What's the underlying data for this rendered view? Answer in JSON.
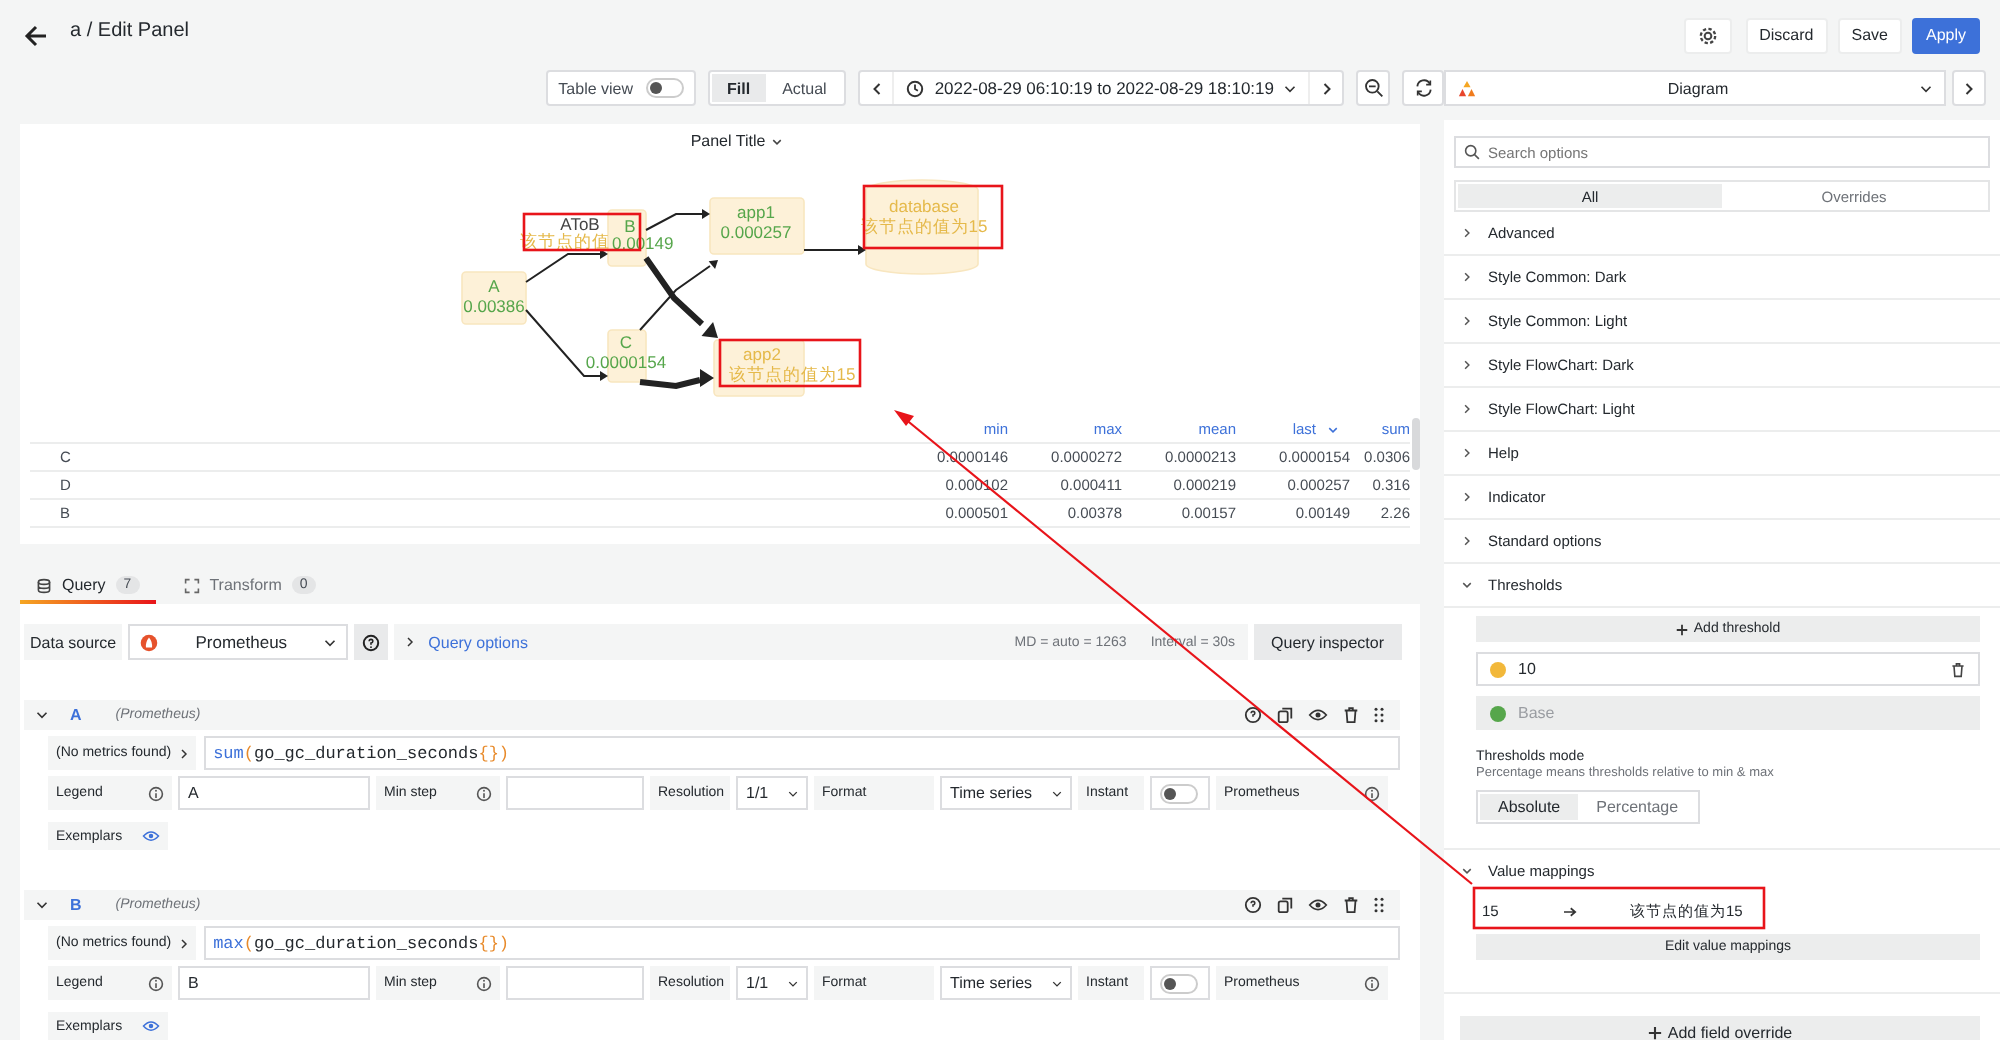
{
  "header": {
    "breadcrumb": "a / Edit Panel",
    "buttons": [
      {
        "label": "Discard",
        "kind": "secondary"
      },
      {
        "label": "Save",
        "kind": "secondary"
      },
      {
        "label": "Apply",
        "kind": "primary"
      }
    ]
  },
  "toolbar": {
    "table_view": {
      "label": "Table view",
      "on": false
    },
    "fill_modes": [
      {
        "label": "Fill",
        "selected": true
      },
      {
        "label": "Actual",
        "selected": false
      }
    ],
    "time_range": "2022-08-29 06:10:19 to 2022-08-29 18:10:19"
  },
  "visualization": {
    "name": "Diagram"
  },
  "panel": {
    "title": "Panel Title",
    "nodes": [
      {
        "label": "A",
        "value": "0.00386",
        "color": "#56a64b"
      },
      {
        "label": "B",
        "value": "0.00149",
        "color": "#56a64b"
      },
      {
        "label": "app1",
        "value": "0.000257",
        "color": "#56a64b"
      },
      {
        "label": "database",
        "value": "该节点的值为15",
        "color": "#e5b94a"
      },
      {
        "label": "C",
        "value": "0.0000154",
        "color": "#56a64b"
      },
      {
        "label": "app2",
        "value": "该节点的值为15",
        "color": "#e5b94a"
      }
    ],
    "edge_label": {
      "label": "AToB",
      "text": "该节点的值"
    },
    "legend": {
      "columns": [
        {
          "label": "min",
          "sorted": false
        },
        {
          "label": "max",
          "sorted": false
        },
        {
          "label": "mean",
          "sorted": false
        },
        {
          "label": "last",
          "sorted": true
        },
        {
          "label": "sum",
          "sorted": false
        }
      ],
      "rows": [
        {
          "name": "C",
          "values": [
            "0.0000146",
            "0.0000272",
            "0.0000213",
            "0.0000154",
            "0.0306"
          ]
        },
        {
          "name": "D",
          "values": [
            "0.000102",
            "0.000411",
            "0.000219",
            "0.000257",
            "0.316"
          ]
        },
        {
          "name": "B",
          "values": [
            "0.000501",
            "0.00378",
            "0.00157",
            "0.00149",
            "2.26"
          ]
        }
      ]
    }
  },
  "query_tabs": [
    {
      "label": "Query",
      "count": "7",
      "selected": true
    },
    {
      "label": "Transform",
      "count": "0",
      "selected": false
    }
  ],
  "data_source": {
    "label": "Data source",
    "value": "Prometheus",
    "options_label": "Query options",
    "md": "MD = auto = 1263",
    "interval": "Interval = 30s",
    "inspector": "Query inspector"
  },
  "queries": [
    {
      "ref": "A",
      "datasource": "(Prometheus)",
      "expanded": true,
      "metrics_button": "(No metrics found)",
      "expr": [
        {
          "kind": "fn",
          "text": "sum"
        },
        {
          "kind": "punct",
          "text": "("
        },
        {
          "kind": "metric",
          "text": "go_gc_duration_seconds"
        },
        {
          "kind": "punct",
          "text": "{})"
        }
      ],
      "legend_label": "Legend",
      "legend": "A",
      "min_step_label": "Min step",
      "resolution_label": "Resolution",
      "resolution": "1/1",
      "format_label": "Format",
      "format": "Time series",
      "instant_label": "Instant",
      "instant": false,
      "type_label": "Prometheus",
      "exemplars_label": "Exemplars"
    },
    {
      "ref": "B",
      "datasource": "(Prometheus)",
      "expanded": true,
      "metrics_button": "(No metrics found)",
      "expr": [
        {
          "kind": "fn",
          "text": "max"
        },
        {
          "kind": "punct",
          "text": "("
        },
        {
          "kind": "metric",
          "text": "go_gc_duration_seconds"
        },
        {
          "kind": "punct",
          "text": "{})"
        }
      ],
      "legend_label": "Legend",
      "legend": "B",
      "min_step_label": "Min step",
      "resolution_label": "Resolution",
      "resolution": "1/1",
      "format_label": "Format",
      "format": "Time series",
      "instant_label": "Instant",
      "instant": false,
      "type_label": "Prometheus",
      "exemplars_label": "Exemplars"
    }
  ],
  "options": {
    "search_placeholder": "Search options",
    "tabs": [
      {
        "label": "All",
        "selected": true
      },
      {
        "label": "Overrides",
        "selected": false
      }
    ],
    "sections": [
      {
        "title": "Advanced",
        "expanded": false
      },
      {
        "title": "Style Common: Dark",
        "expanded": false
      },
      {
        "title": "Style Common: Light",
        "expanded": false
      },
      {
        "title": "Style FlowChart: Dark",
        "expanded": false
      },
      {
        "title": "Style FlowChart: Light",
        "expanded": false
      },
      {
        "title": "Help",
        "expanded": false
      },
      {
        "title": "Indicator",
        "expanded": false
      },
      {
        "title": "Standard options",
        "expanded": false
      },
      {
        "title": "Thresholds",
        "expanded": true
      }
    ]
  },
  "thresholds": {
    "add_label": "Add threshold",
    "steps": [
      {
        "value": "10",
        "color": "#f2b83a",
        "base": false
      },
      {
        "value": "Base",
        "color": "#56a64b",
        "base": true
      }
    ],
    "mode_title": "Thresholds mode",
    "mode_description": "Percentage means thresholds relative to min & max",
    "modes": [
      {
        "label": "Absolute",
        "selected": true
      },
      {
        "label": "Percentage",
        "selected": false
      }
    ]
  },
  "value_mappings": {
    "title": "Value mappings",
    "expanded": true,
    "mappings": [
      {
        "value": "15",
        "text": "该节点的值为15"
      }
    ],
    "edit_label": "Edit value mappings"
  },
  "add_override": "Add field override"
}
